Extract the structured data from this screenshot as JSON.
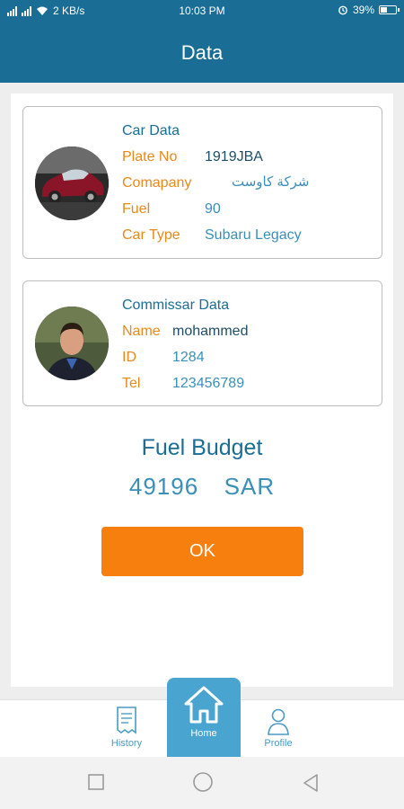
{
  "status_bar": {
    "network_speed": "2 KB/s",
    "time": "10:03 PM",
    "battery": "39%",
    "battery_level": 0.39,
    "icons": [
      "signal-icon",
      "signal-icon",
      "wifi-icon",
      "alarm-icon",
      "battery-icon"
    ]
  },
  "app_bar": {
    "title": "Data"
  },
  "car": {
    "heading": "Car Data",
    "image_icon": "car-photo",
    "plate_label": "Plate No",
    "plate_value": "1919JBA",
    "company_label": "Comapany",
    "company_value": "شركة كاوست",
    "fuel_label": "Fuel",
    "fuel_value": "90",
    "type_label": "Car Type",
    "type_value": "Subaru Legacy"
  },
  "commissar": {
    "heading": "Commissar Data",
    "image_icon": "person-photo",
    "name_label": "Name",
    "name_value": "mohammed",
    "id_label": "ID",
    "id_value": "1284",
    "tel_label": "Tel",
    "tel_value": "123456789"
  },
  "budget": {
    "title": "Fuel Budget",
    "value": "49196  SAR"
  },
  "ok_button": {
    "label": "OK"
  },
  "bottom_nav": {
    "items": [
      {
        "label": "History",
        "icon": "receipt-icon"
      },
      {
        "label": "Home",
        "icon": "home-icon"
      },
      {
        "label": "Profile",
        "icon": "profile-icon"
      }
    ]
  },
  "system_nav": {
    "icons": [
      "square-icon",
      "circle-icon",
      "triangle-back-icon"
    ]
  },
  "colors": {
    "primary": "#1a6d95",
    "accent": "#f77f0d",
    "label": "#e8891c",
    "value": "#3a8fb8",
    "nav_active": "#4aa4d0"
  }
}
